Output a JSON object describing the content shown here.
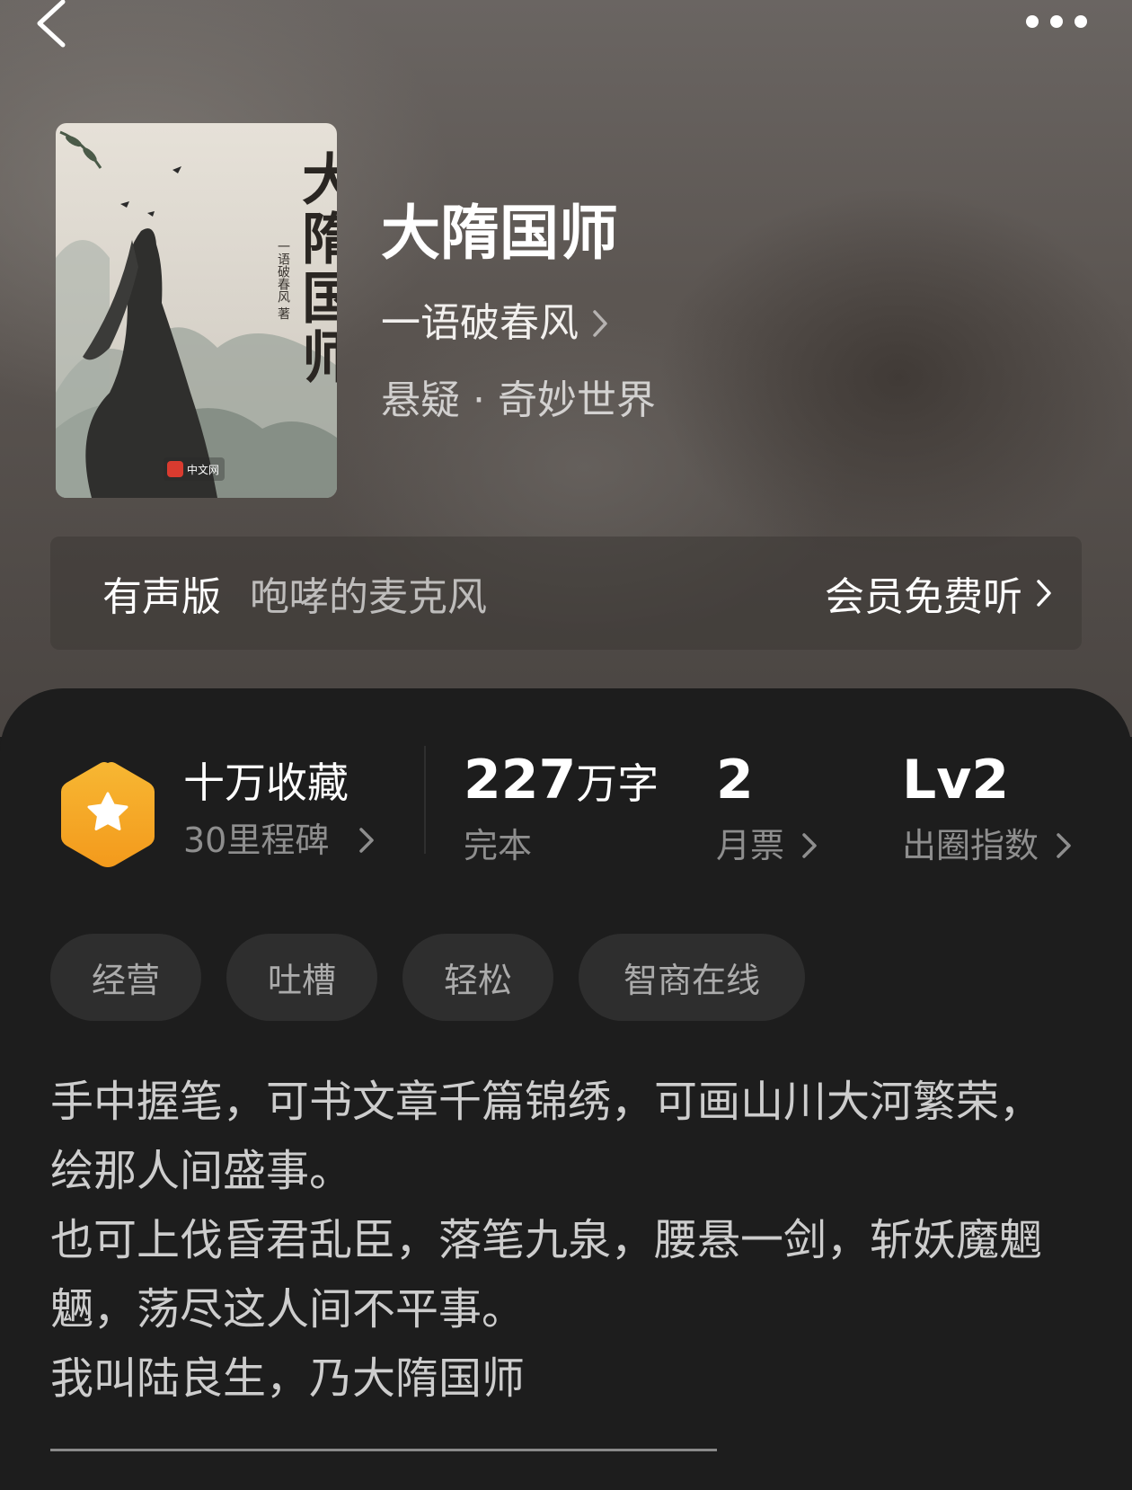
{
  "book": {
    "title": "大隋国师",
    "author": "一语破春风",
    "genre": "悬疑 · 奇妙世界"
  },
  "cover": {
    "title": "大隋国师",
    "author_line": "一语破春风 著",
    "publisher": "中文网"
  },
  "audio": {
    "label": "有声版",
    "narrator": "咆哮的麦克风",
    "cta": "会员免费听"
  },
  "stats": {
    "milestone_title": "十万收藏",
    "milestone_sub": "30里程碑",
    "word_count": "227",
    "word_unit": "万字",
    "status": "完本",
    "monthly_tickets": "2",
    "monthly_tickets_label": "月票",
    "level": "Lv2",
    "level_label": "出圈指数"
  },
  "tags": [
    "经营",
    "吐槽",
    "轻松",
    "智商在线"
  ],
  "description": [
    "手中握笔，可书文章千篇锦绣，可画山川大河繁荣，绘那人间盛事。",
    "也可上伐昏君乱臣，落笔九泉，腰悬一剑，斩妖魔魍魉，荡尽这人间不平事。",
    "我叫陆良生，乃大隋国师"
  ],
  "icons": {
    "back": "chevron-left-icon",
    "more": "more-dots-icon",
    "badge": "star-hexagon-icon",
    "chevron": "chevron-right-icon"
  },
  "colors": {
    "badge": "#f5a623",
    "panel_bg": "#1d1d1d",
    "tag_bg": "#2e2e2e"
  }
}
